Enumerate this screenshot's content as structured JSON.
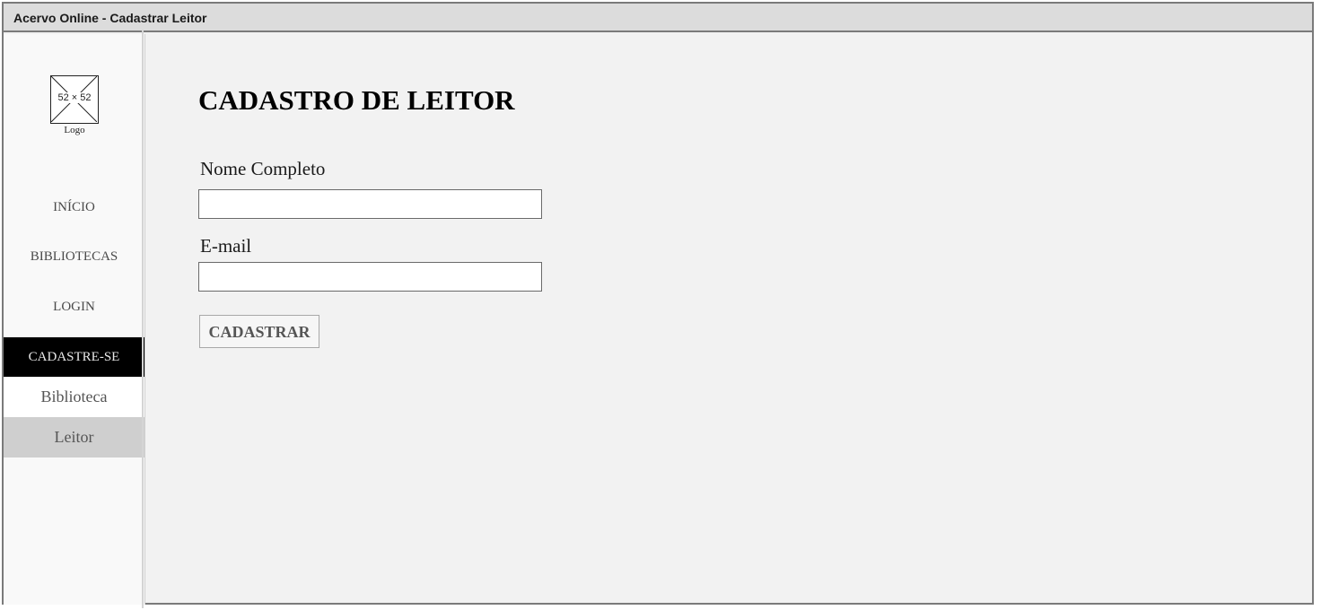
{
  "window": {
    "title": "Acervo Online - Cadastrar Leitor"
  },
  "sidebar": {
    "logo": {
      "placeholder_dimensions": "52 × 52",
      "caption": "Logo"
    },
    "items": [
      {
        "label": "INÍCIO",
        "active": false
      },
      {
        "label": "BIBLIOTECAS",
        "active": false
      },
      {
        "label": "LOGIN",
        "active": false
      },
      {
        "label": "CADASTRE-SE",
        "active": true
      }
    ],
    "subitems": [
      {
        "label": "Biblioteca",
        "active": false
      },
      {
        "label": "Leitor",
        "active": true
      }
    ]
  },
  "main": {
    "title": "CADASTRO DE LEITOR",
    "form": {
      "name_label": "Nome Completo",
      "name_value": "",
      "email_label": "E-mail",
      "email_value": "",
      "submit_label": "CADASTRAR"
    }
  },
  "colors": {
    "active_nav_bg": "#000000",
    "active_subnav_bg": "#cfcfcf",
    "content_bg": "#f2f2f2",
    "titlebar_bg": "#dcdcdc"
  }
}
